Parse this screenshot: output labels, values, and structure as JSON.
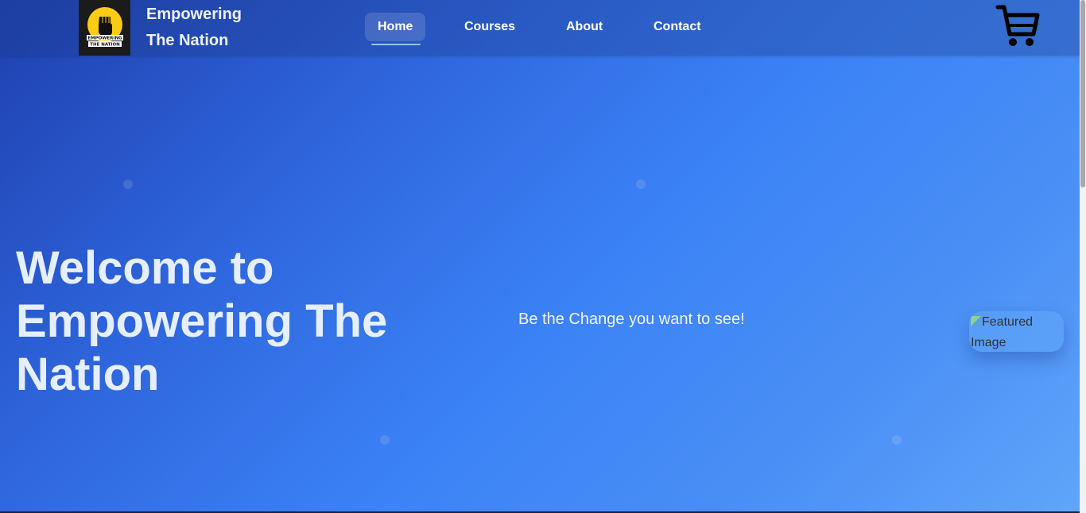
{
  "brand": {
    "name_line1": "Empowering",
    "name_line2": "The Nation",
    "logo_text_line1": "EMPOWERING",
    "logo_text_line2": "THE NATION"
  },
  "nav": {
    "items": [
      {
        "label": "Home",
        "active": true
      },
      {
        "label": "Courses",
        "active": false
      },
      {
        "label": "About",
        "active": false
      },
      {
        "label": "Contact",
        "active": false
      }
    ]
  },
  "cart": {
    "icon": "shopping-cart-icon"
  },
  "hero": {
    "title": "Welcome to Empowering The Nation",
    "tagline": "Be the Change you want to see!",
    "featured_image_alt": "Featured Image"
  },
  "colors": {
    "gradient_start": "#1e40af",
    "gradient_mid": "#3b82f6",
    "gradient_end": "#60a5fa",
    "title_text": "#e6efff",
    "logo_yellow": "#facc15"
  }
}
